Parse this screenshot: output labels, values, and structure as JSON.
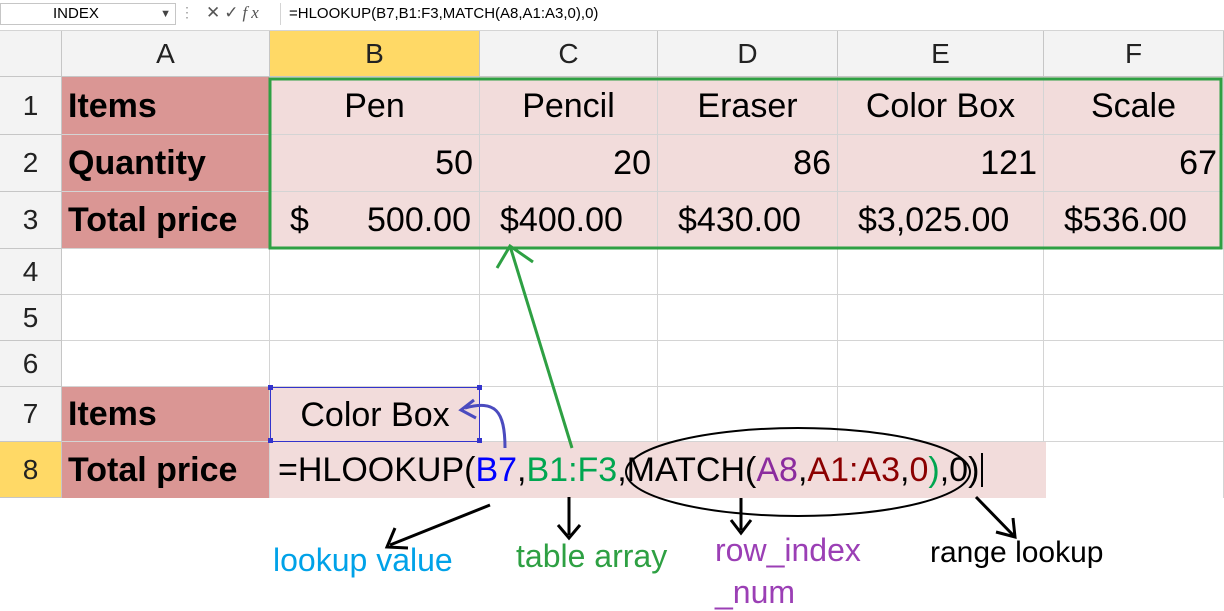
{
  "formula_bar": {
    "name_box": "INDEX",
    "formula": "=HLOOKUP(B7,B1:F3,MATCH(A8,A1:A3,0),0)",
    "icons": [
      "cancel-icon",
      "enter-icon",
      "function-icon"
    ]
  },
  "columns": [
    "A",
    "B",
    "C",
    "D",
    "E",
    "F"
  ],
  "rows": [
    "1",
    "2",
    "3",
    "4",
    "5",
    "6",
    "7",
    "8"
  ],
  "table": {
    "labels": [
      "Items",
      "Quantity",
      "Total price"
    ],
    "items": [
      "Pen",
      "Pencil",
      "Eraser",
      "Color Box",
      "Scale"
    ],
    "quantities": [
      "50",
      "20",
      "86",
      "121",
      "67"
    ],
    "prices": [
      "500.00",
      "400.00",
      "430.00",
      "3,025.00",
      "536.00"
    ],
    "currency": "$"
  },
  "lookup": {
    "items_label": "Items",
    "items_value": "Color Box",
    "total_label": "Total price",
    "formula_parts": {
      "f1": "=HLOOKUP(",
      "b7": "B7",
      "c1": ",",
      "range": "B1:F3",
      "c2": ",MATCH(",
      "a8": "A8",
      "c3": ",",
      "a1a3": "A1:A3",
      "c4": ",",
      "zero1": "0",
      "p1": ")",
      "c5": ",0)"
    }
  },
  "annotations": {
    "lookup_value": "lookup value",
    "table_array": "table array",
    "row_index_num_1": "row_index",
    "row_index_num_2": "_num",
    "range_lookup": "range lookup"
  },
  "colors": {
    "label_fill": "#da9694",
    "data_fill": "#f2dcdb",
    "selected_header": "#ffd966",
    "green": "#00a650",
    "blue": "#0000ff",
    "purple": "#8b2c9e",
    "dark_red": "#8b0000",
    "cyan": "#00a2e8"
  }
}
